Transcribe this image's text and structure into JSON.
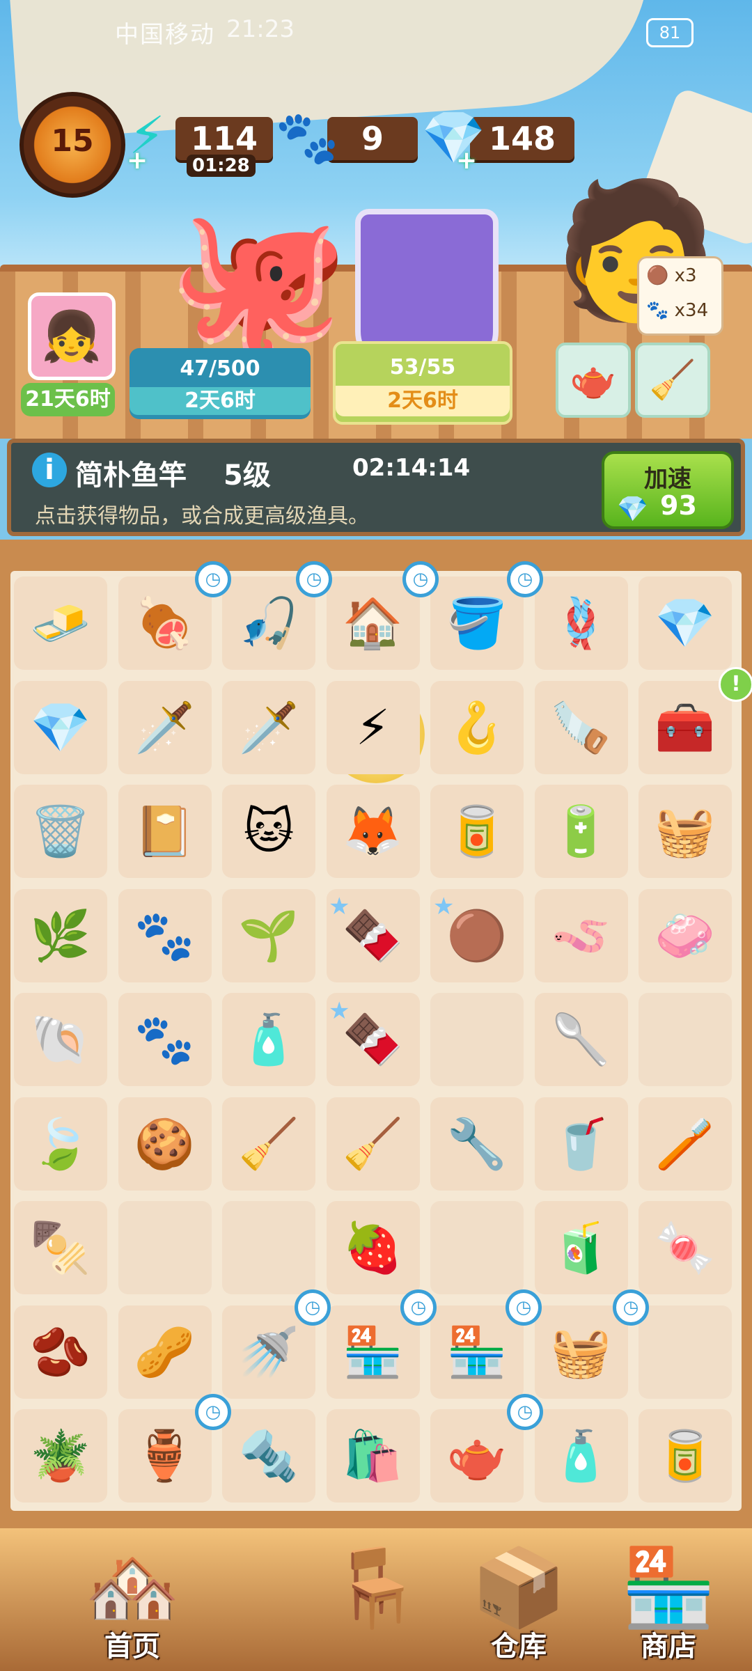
{
  "status_bar": {
    "carrier": "中国移动",
    "time": "21:23",
    "battery": "81"
  },
  "resources": {
    "level": "15",
    "energy": "114",
    "energy_timer": "01:28",
    "paws": "9",
    "gems": "148"
  },
  "events": {
    "avatar_timer": "21天6时",
    "paw_progress": "47/500",
    "paw_timer": "2天6时",
    "order_progress": "53/55",
    "order_timer": "2天6时"
  },
  "order_bubble": {
    "ball_count": "x3",
    "paw_count": "x34"
  },
  "selected_item": {
    "name": "简朴鱼竿",
    "level": "5级",
    "timer": "02:14:14",
    "description": "点击获得物品，或合成更高级渔具。",
    "speed_label": "加速",
    "speed_cost": "93"
  },
  "board": {
    "rows": [
      [
        "🧈",
        "🍖",
        "🎣",
        "🏠",
        "🪣",
        "🪢",
        "💎"
      ],
      [
        "💎",
        "🗡️",
        "🗡️",
        "⚡",
        "🪝",
        "🪚",
        "🧰"
      ],
      [
        "🗑️",
        "📔",
        "🐱",
        "🦊",
        "🥫",
        "🔋",
        "🧺"
      ],
      [
        "🌿",
        "🐾",
        "🌱",
        "🍫",
        "🟤",
        "🪱",
        "🧼"
      ],
      [
        "🐚",
        "🐾",
        "🧴",
        "🍫",
        "",
        "🥄",
        ""
      ],
      [
        "🍃",
        "🍪",
        "🧹",
        "🧹",
        "🔧",
        "🥤",
        "🪥"
      ],
      [
        "🍢",
        "",
        "",
        "🍓",
        "",
        "🧃",
        "🍬"
      ],
      [
        "🫘",
        "🥜",
        "🚿",
        "🏪",
        "🏪",
        "🧺",
        ""
      ],
      [
        "🪴",
        "🏺",
        "🔩",
        "🛍️",
        "🫖",
        "🧴",
        "🥫"
      ]
    ]
  },
  "nav": {
    "home": "首页",
    "warehouse": "仓库",
    "shop": "商店"
  },
  "colors": {
    "accent": "#58b41d",
    "board_bg": "#f5e8d4",
    "frame": "#c98b4f"
  }
}
